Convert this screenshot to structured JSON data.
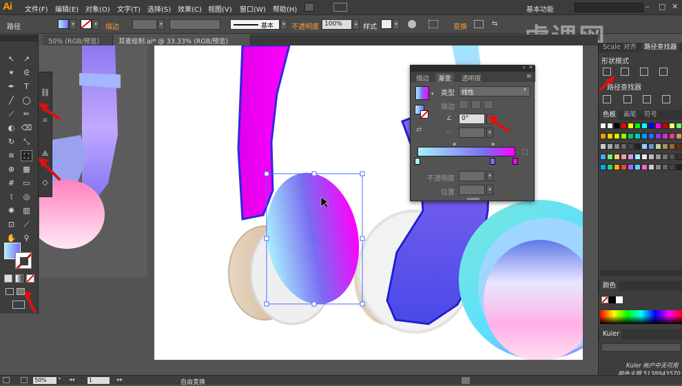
{
  "app": {
    "logo": "Ai"
  },
  "menu": [
    "文件(F)",
    "编辑(E)",
    "对象(O)",
    "文字(T)",
    "选择(S)",
    "效果(C)",
    "视图(V)",
    "窗口(W)",
    "帮助(H)"
  ],
  "workspace": {
    "label": "基本功能"
  },
  "control": {
    "object_type": "路径",
    "stroke_label": "描边",
    "brush_label": "基本",
    "opacity_label": "不透明度",
    "opacity_value": "100%",
    "style_label": "样式",
    "transform_label": "变换"
  },
  "doc_tabs": [
    "50% (RGB/预览)",
    "耳麦绘制.ai* @ 33.33% (RGB/预览)"
  ],
  "gradient_panel": {
    "tabs": [
      "描边",
      "渐变",
      "透明度"
    ],
    "type_label": "类型",
    "type_value": "线性",
    "stroke_label": "描边",
    "angle_value": "0°",
    "opacity_label": "不透明度",
    "position_label": "位置"
  },
  "right_panel": {
    "top_tabs": [
      "Scale",
      "对齐",
      "路径查找器"
    ],
    "shape_modes_label": "形状模式",
    "pathfinder_label": "路径查找器",
    "swatch_tabs": [
      "色板",
      "画笔",
      "符号"
    ],
    "color_tab": "颜色",
    "kuler_tab": "Kuler",
    "kuler_note_1": "Kuler 帐户中无可用",
    "kuler_note_2": "颜色主题 5138943570"
  },
  "status": {
    "zoom": "50%",
    "page": "1",
    "tool": "自由变换"
  },
  "watermark": "虎课网",
  "colors": {
    "gradient_start": "#a8f0ff",
    "gradient_mid": "#7a6cf0",
    "gradient_end": "#ff00ff",
    "accent_arrow": "#e01010"
  }
}
